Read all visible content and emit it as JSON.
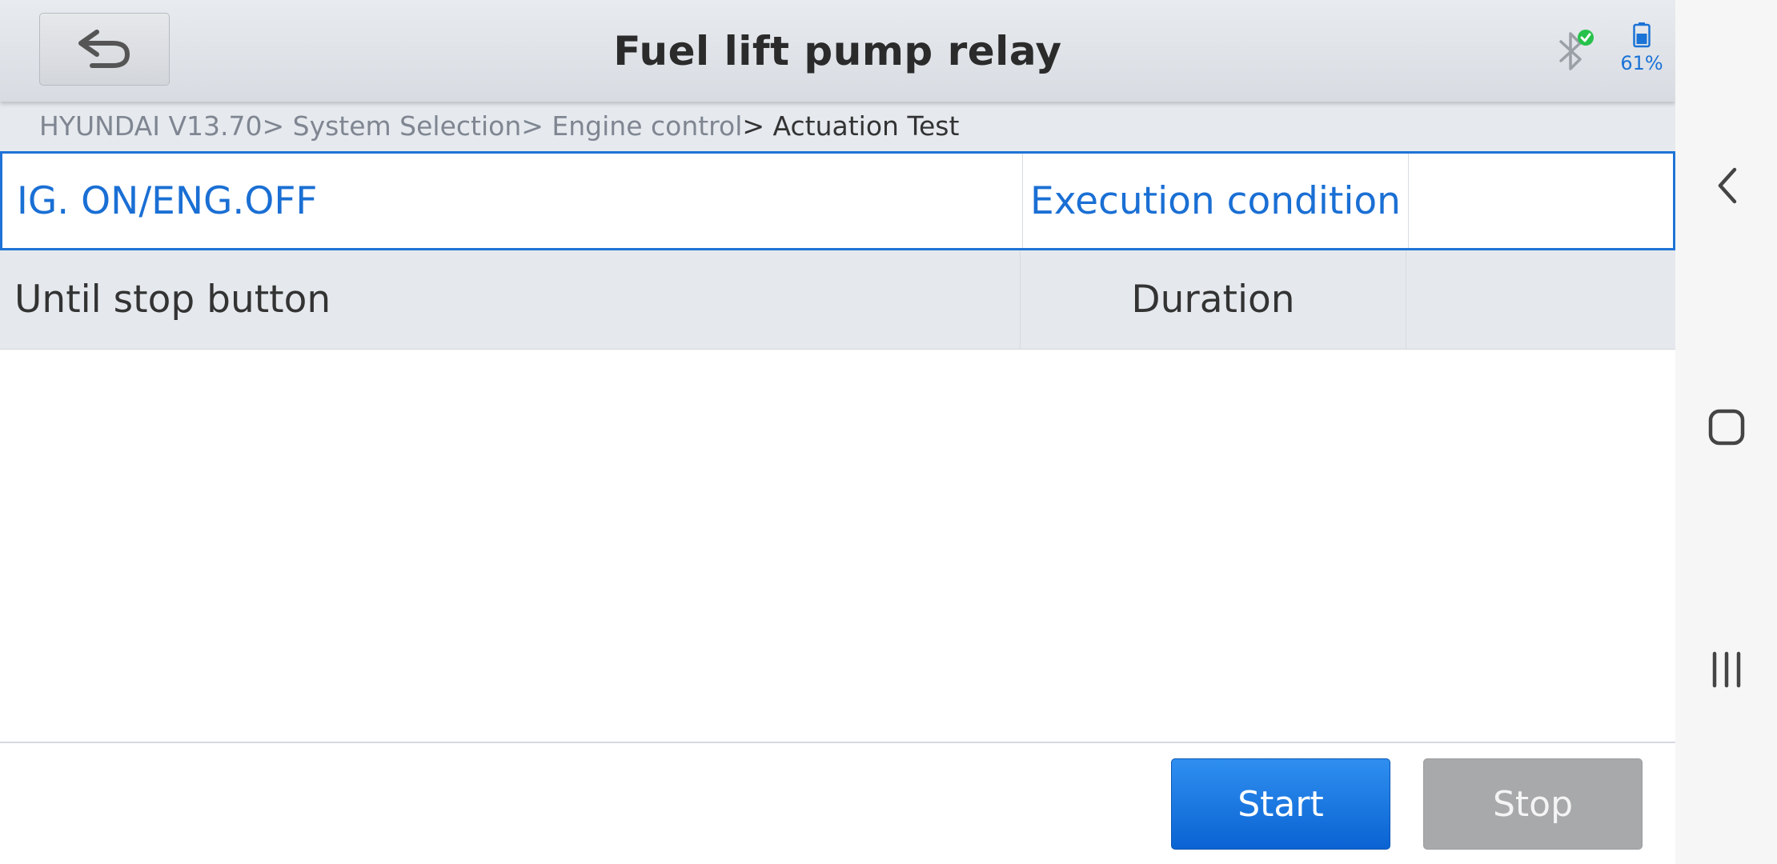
{
  "header": {
    "title": "Fuel lift pump relay",
    "battery_percent": "61%",
    "bluetooth_status": "connected",
    "accent_color": "#1a73d6"
  },
  "breadcrumb": {
    "items": [
      "HYUNDAI V13.70",
      "> System Selection",
      "> Engine control"
    ],
    "current": "> Actuation Test"
  },
  "table": {
    "rows": [
      {
        "col1": "IG. ON/ENG.OFF",
        "col2": "Execution condition",
        "col3": "",
        "selected": true
      },
      {
        "col1": "Until stop button",
        "col2": "Duration",
        "col3": "",
        "selected": false
      }
    ]
  },
  "actions": {
    "start_label": "Start",
    "stop_label": "Stop"
  },
  "icons": {
    "back": "back-arrow-icon",
    "bluetooth": "bluetooth-icon",
    "battery": "battery-icon",
    "nav_back": "chevron-left-icon",
    "nav_home": "home-square-icon",
    "nav_recents": "recents-icon"
  }
}
